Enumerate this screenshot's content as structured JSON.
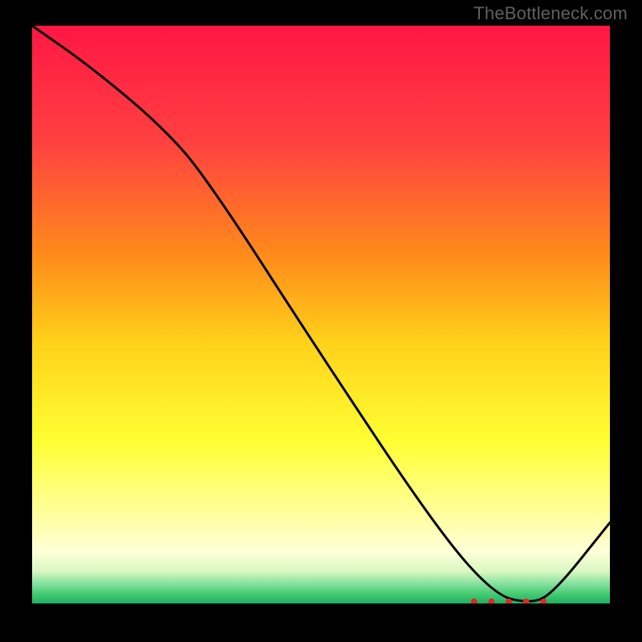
{
  "watermark": "TheBottleneck.com",
  "zoom_label": "",
  "chart_data": {
    "type": "line",
    "title": "",
    "xlabel": "",
    "ylabel": "",
    "xlim": [
      0,
      1
    ],
    "ylim": [
      0,
      1
    ],
    "background_gradient": {
      "stops": [
        {
          "offset": 0.0,
          "color": "#ff1744"
        },
        {
          "offset": 0.2,
          "color": "#ff4040"
        },
        {
          "offset": 0.4,
          "color": "#ff8c1a"
        },
        {
          "offset": 0.55,
          "color": "#ffd21a"
        },
        {
          "offset": 0.72,
          "color": "#ffff33"
        },
        {
          "offset": 0.86,
          "color": "#ffffaa"
        },
        {
          "offset": 0.91,
          "color": "#ffffd8"
        },
        {
          "offset": 0.945,
          "color": "#d8f7c0"
        },
        {
          "offset": 0.965,
          "color": "#88e2a0"
        },
        {
          "offset": 0.985,
          "color": "#3fc96f"
        },
        {
          "offset": 1.0,
          "color": "#20b060"
        }
      ]
    },
    "series": [
      {
        "name": "bottleneck-curve",
        "x": [
          0.0,
          0.1,
          0.22,
          0.3,
          0.5,
          0.7,
          0.8,
          0.86,
          0.9,
          1.0
        ],
        "y": [
          1.0,
          0.93,
          0.83,
          0.74,
          0.43,
          0.13,
          0.015,
          0.0,
          0.015,
          0.14
        ]
      }
    ],
    "markers": {
      "name": "sweet-spot-dots",
      "color": "#e02828",
      "points": [
        {
          "x": 0.765,
          "y": 0.003
        },
        {
          "x": 0.795,
          "y": 0.003
        },
        {
          "x": 0.825,
          "y": 0.003
        },
        {
          "x": 0.855,
          "y": 0.003
        },
        {
          "x": 0.885,
          "y": 0.003
        }
      ]
    }
  }
}
